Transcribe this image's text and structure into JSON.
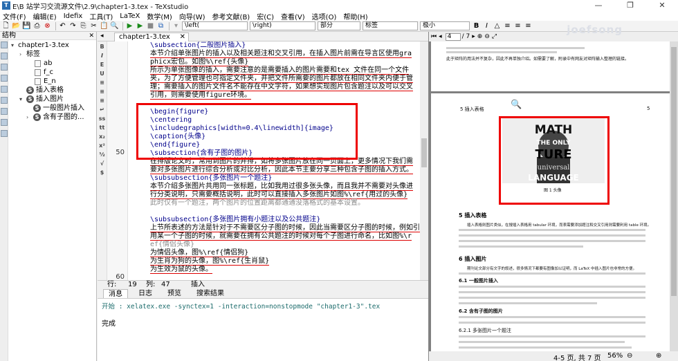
{
  "window": {
    "title": "E\\B 站学习交流源文件\\2.9\\chapter1-3.tex - TeXstudio",
    "controls": [
      "—",
      "❐",
      "✕"
    ]
  },
  "menu": [
    "文件(F)",
    "编辑(E)",
    "Idefix",
    "工具(T)",
    "LaTeX",
    "数学(M)",
    "向导(W)",
    "参考文献(B)",
    "宏(C)",
    "查看(V)",
    "选项(O)",
    "帮助(H)"
  ],
  "toolbar": {
    "combo_left": "\\left(",
    "combo_right": "\\right)",
    "combo_section": "部分",
    "combo_label": "标签",
    "combo_size": "极小"
  },
  "structure": {
    "title": "结构",
    "items": [
      {
        "label": "chapter1-3.tex",
        "level": 0,
        "arrow": "▾"
      },
      {
        "label": "标签",
        "level": 1,
        "arrow": "›"
      },
      {
        "label": "ab",
        "level": 2,
        "arrow": ""
      },
      {
        "label": "f_c",
        "level": 2,
        "arrow": ""
      },
      {
        "label": "E_n",
        "level": 2,
        "arrow": ""
      },
      {
        "label": "插入表格",
        "level": 1,
        "arrow": ""
      },
      {
        "label": "插入图片",
        "level": 1,
        "arrow": "▾"
      },
      {
        "label": "一般图片插入",
        "level": 2,
        "arrow": ""
      },
      {
        "label": "含有子图的...",
        "level": 2,
        "arrow": "›"
      }
    ]
  },
  "editor": {
    "tab_label": "chapter1-3.tex",
    "line_number_50": "50",
    "line_number_60": "60",
    "lines": [
      "\\subsection{二般图片插入}",
      "本节介绍单张图片的插入以及相关题注和交叉引用，在插入图片前需在导言区使用gra",
      "phicx宏包。如图%\\ref{头像}",
      "所示为单张图像的插入，需要注意的是需要插入的图片需要和tex 文件在同一个文件",
      "夹，为了方便管理也可指定文件夹，并把文件所需要的图片都放在相同文件夹内便于管",
      "理；需要插入的图片文件名不能存在中文字符，如果想实现图片包含题注以及可以交叉",
      "引用，则需要使用figure环境。",
      "",
      "\\begin{figure}",
      "    \\centering",
      "    \\includegraphics[width=0.4\\linewidth]{image}",
      "    \\caption{头像}",
      "\\end{figure}",
      "\\subsection{含有子图的图片}",
      "在排版论文时，常用到图片的并排，如将多张图片放在同一页面上，更多情况下我们需",
      "要对多张图片进行综合分析或对比分析，因此本节主要分享三种包含子图的插入方式。",
      "\\subsubsection{多张图片一个题注}",
      "本节介绍多张图片共用同一张标题，比如我用过很多张头像，而且我并不需要对头像进",
      "行分类说明，只需要概括说明，此时可以直接插入多张图片如图%\\ref{用过的头像}",
      "此时仅有一个题注，两个图片的位置距离都通通没落格式的基本设置。",
      "",
      "",
      "\\subsubsection{多张图片拥有小题注以及公共题注}",
      "上节所表述的方法是针对于不需要区分子图的时候，因此当需要区分子图的时候，例如引",
      "用某一个子图的时候，就需要在拥有公共题注的时候对每个子图进行命名，比如图%\\r",
      "ef{情侣头像}",
      "为情侣头像，图%\\ref{情侣狗}",
      "为生肖为狗的头像，图%\\ref{生肖鼠}",
      "为生效为鼠的头像。"
    ]
  },
  "status": {
    "row_label": "行:",
    "row_value": "19",
    "col_label": "列:",
    "col_value": "47",
    "mode": "插入"
  },
  "messages": {
    "tabs": [
      "消息",
      "日志",
      "预览",
      "搜索结果"
    ],
    "command": "开始 : xelatex.exe -synctex=1 -interaction=nonstopmode \"chapter1-3\".tex",
    "result": "完成"
  },
  "pdf": {
    "page_current": "4",
    "page_total": "/ 7",
    "watermark": "joefsong",
    "header_left": "5    插入表格",
    "header_right": "5",
    "image_words": [
      "MATH",
      "THE ONLY",
      "TURE",
      "universal",
      "LANGUAGE"
    ],
    "figure_caption": "图 1 头像",
    "section5": "5    插入表格",
    "section6": "6    插入图片",
    "sub61": "6.1    一般图片插入",
    "sub62": "6.2    含有子图的图片",
    "sub621": "6.2.1    多张图片一个题注",
    "top_text": "此于矩阵的用法并不复杂，因此不再单独介绍。如需要了解，附录中有网友对矩阵输入整理的链接。",
    "para5": "插入表格则图片类似，在搜插入表格用 tabular 环境，而表需要添加题注和交叉引用则需要利用 table 环境。",
    "para6": "期刊论文部分有文字的叙述，很多情况下都要有图像加以证明，而 LaTeX 中插入图片也非常的方便。",
    "page_status": "4-5 页, 共 7 页",
    "zoom": "56%"
  }
}
